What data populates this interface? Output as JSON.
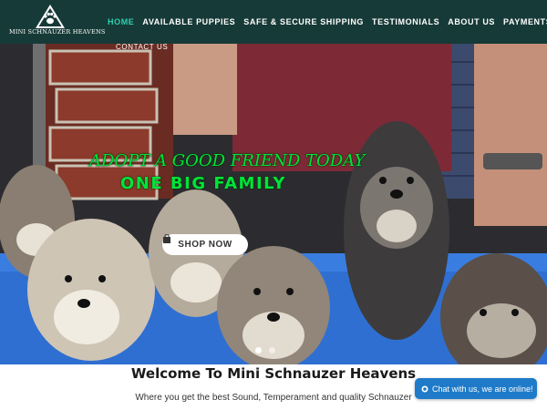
{
  "brand": {
    "logo_text": "MINI SCHNAUZER HEAVENS",
    "logo_icon": "paw-triangle-logo"
  },
  "nav": {
    "items": [
      {
        "label": "HOME",
        "active": true
      },
      {
        "label": "AVAILABLE PUPPIES",
        "active": false
      },
      {
        "label": "SAFE & SECURE SHIPPING",
        "active": false
      },
      {
        "label": "TESTIMONIALS",
        "active": false
      },
      {
        "label": "ABOUT US",
        "active": false
      },
      {
        "label": "PAYMENTS",
        "active": false
      }
    ],
    "row2": {
      "label": "CONTACT US"
    }
  },
  "hero": {
    "title": "ADOPT A GOOD FRIEND TODAY",
    "subtitle": "ONE BIG FAMILY",
    "cta_label": "SHOP NOW",
    "cta_icon": "shopping-bag-icon",
    "slide_count": 2,
    "active_slide": 1
  },
  "welcome": {
    "title": "Welcome To Mini Schnauzer Heavens",
    "subtitle": "Where you get the best Sound, Temperament and quality Schnauzer"
  },
  "chat": {
    "label": "Chat with us, we are online!",
    "icon": "chat-icon"
  },
  "colors": {
    "header_bg": "#163a37",
    "nav_active": "#2fd0b2",
    "hero_text": "#00e43a",
    "chat_bg": "#1f7bc9"
  }
}
